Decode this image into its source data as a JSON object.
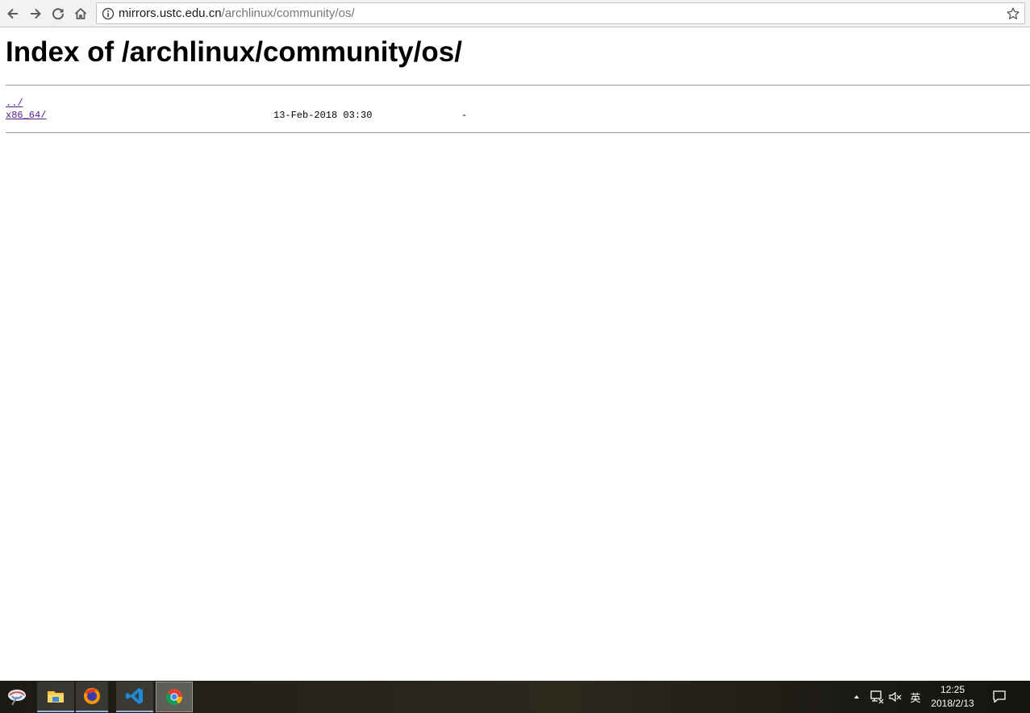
{
  "browser": {
    "url_host": "mirrors.ustc.edu.cn",
    "url_path": "/archlinux/community/os/",
    "icons": [
      "back-icon",
      "forward-icon",
      "reload-icon",
      "home-icon",
      "info-icon",
      "star-icon"
    ]
  },
  "page": {
    "title": "Index of /archlinux/community/os/",
    "entries": [
      {
        "name": "../",
        "date": "",
        "size": ""
      },
      {
        "name": "x86_64/",
        "date": "13-Feb-2018 03:30",
        "size": "-"
      }
    ]
  },
  "taskbar": {
    "apps": [
      "start-icon",
      "file-explorer-icon",
      "firefox-icon",
      "vscode-icon",
      "chrome-icon"
    ],
    "tray": {
      "ime": "英",
      "time": "12:25",
      "date": "2018/2/13"
    }
  },
  "colors": {
    "link": "#551a8b",
    "toolbar": "#f2f2f2",
    "taskbar": "#25221a"
  }
}
